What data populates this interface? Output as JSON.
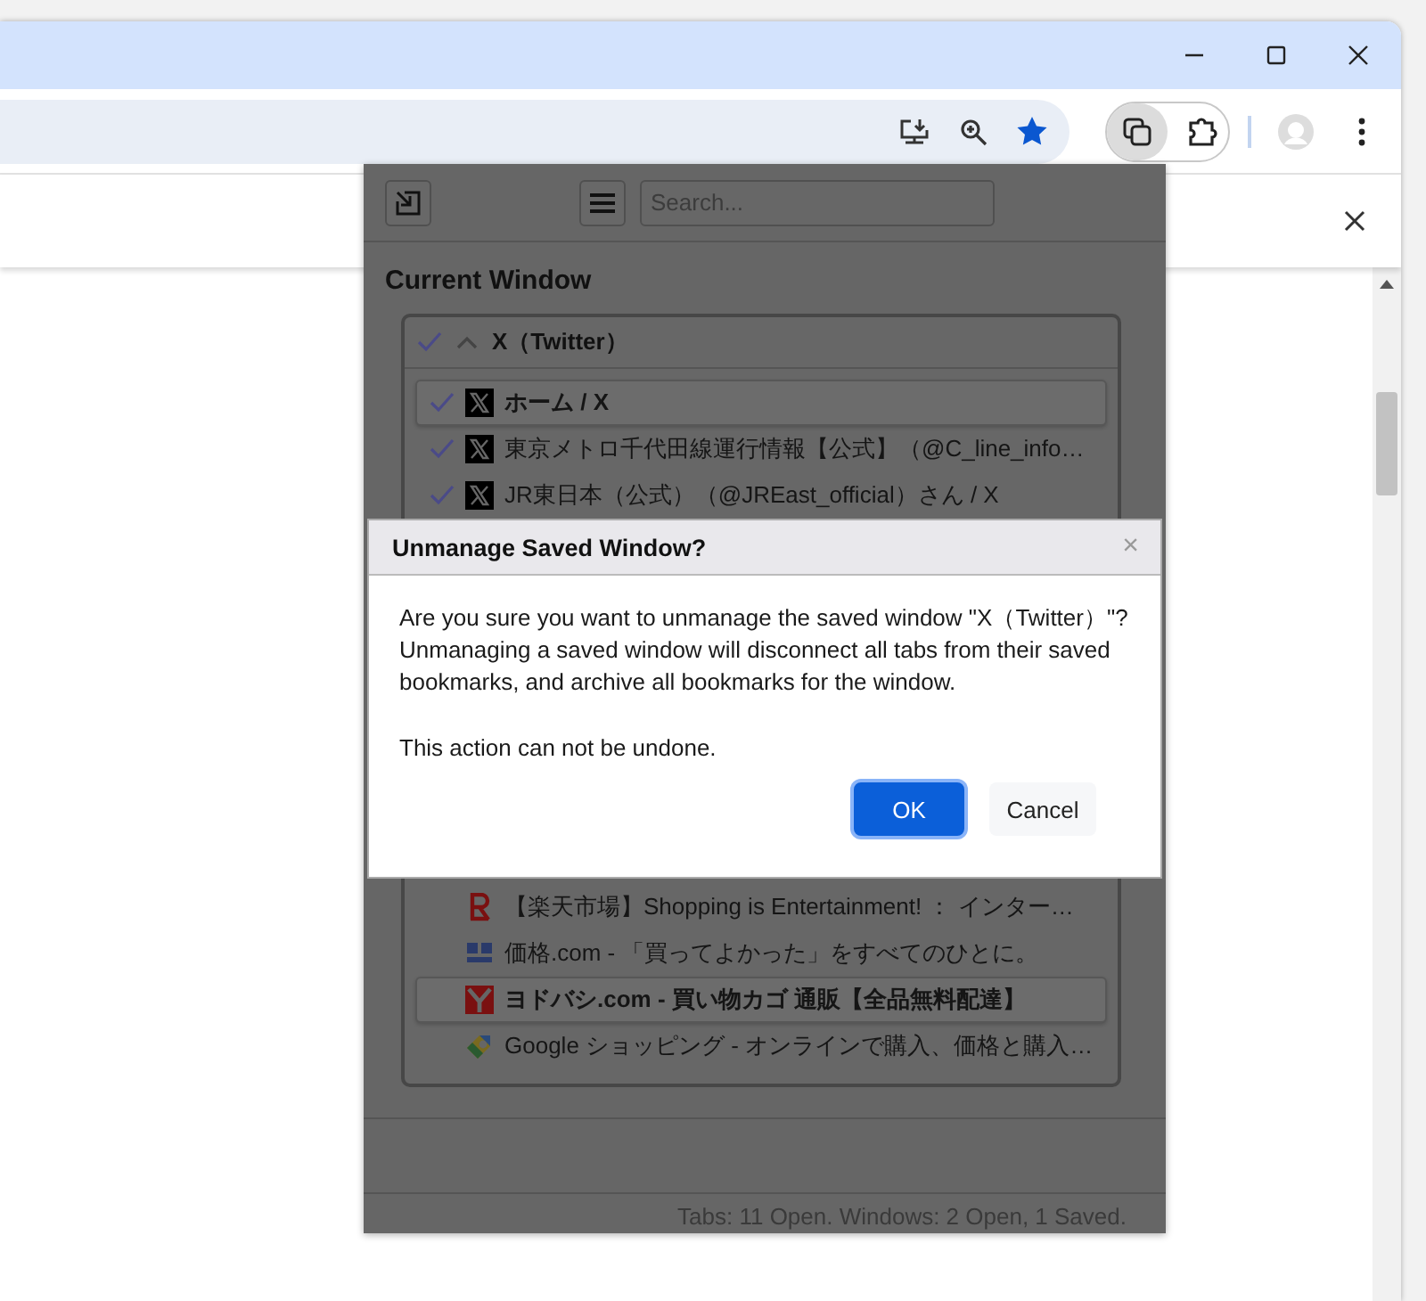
{
  "popup": {
    "search": {
      "placeholder": "Search..."
    },
    "section_title": "Current Window",
    "group": {
      "title": "X（Twitter）",
      "checked": true,
      "expanded": true,
      "tabs": [
        {
          "title": "ホーム / X",
          "kind": "x",
          "checked": true,
          "selected": true
        },
        {
          "title": "東京メトロ千代田線運行情報【公式】（@C_line_info…",
          "kind": "x",
          "checked": true,
          "selected": false
        },
        {
          "title": "JR東日本（公式）（@JREast_official）さん / X",
          "kind": "x",
          "checked": true,
          "selected": false
        },
        {
          "title": "【楽天市場】Shopping is Entertainment! ： インター…",
          "kind": "rakuten",
          "checked": false,
          "selected": false
        },
        {
          "title": "価格.com - 「買ってよかった」をすべてのひとに。",
          "kind": "kakaku",
          "checked": false,
          "selected": false
        },
        {
          "title": "ヨドバシ.com - 買い物カゴ 通販【全品無料配達】",
          "kind": "yodobashi",
          "checked": false,
          "selected": true
        },
        {
          "title": "Google ショッピング - オンラインで購入、価格と購入…",
          "kind": "gshop",
          "checked": false,
          "selected": false
        }
      ]
    },
    "status": "Tabs: 11 Open. Windows: 2 Open, 1 Saved."
  },
  "dialog": {
    "title": "Unmanage Saved Window?",
    "close": "×",
    "message": "Are you sure you want to unmanage the saved window \"X（Twitter）\"? Unmanaging a saved window will disconnect all tabs from their saved bookmarks, and archive all bookmarks for the window.",
    "note": "This action can not be undone.",
    "buttons": [
      {
        "label": "OK",
        "kind": "primary"
      },
      {
        "label": "Cancel",
        "kind": "secondary"
      }
    ]
  }
}
